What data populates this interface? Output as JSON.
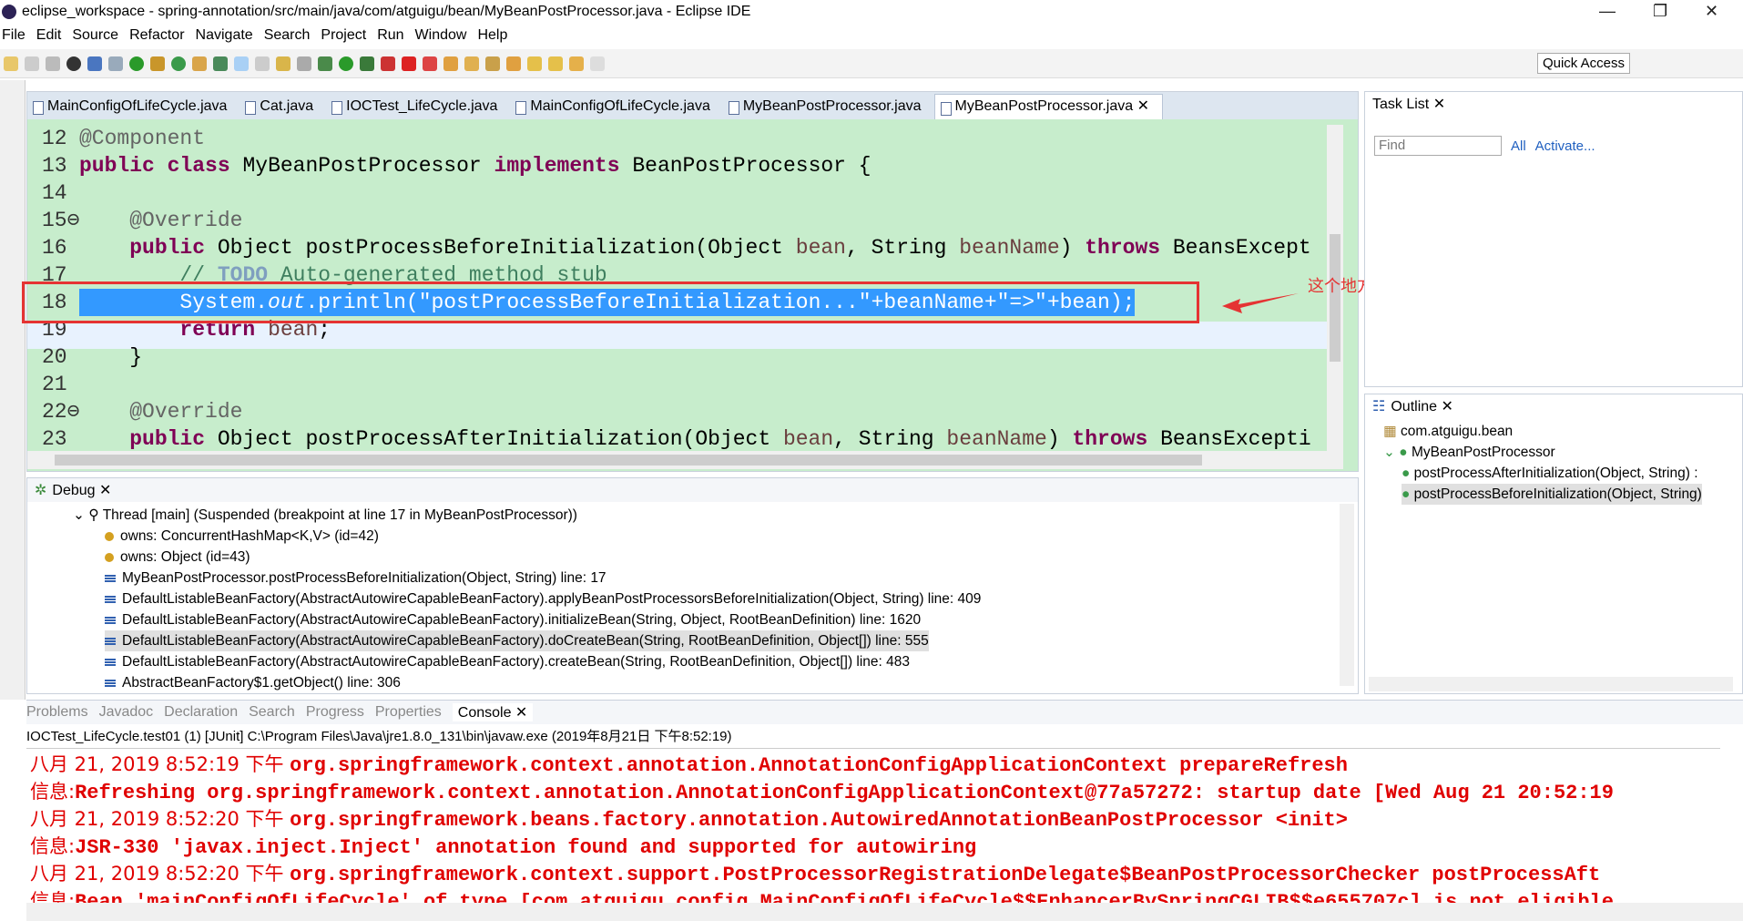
{
  "window": {
    "title": "eclipse_workspace - spring-annotation/src/main/java/com/atguigu/bean/MyBeanPostProcessor.java - Eclipse IDE",
    "minimize": "—",
    "restore": "❐",
    "close": "✕"
  },
  "menu": [
    "File",
    "Edit",
    "Source",
    "Refactor",
    "Navigate",
    "Search",
    "Project",
    "Run",
    "Window",
    "Help"
  ],
  "toolbar": {
    "quick_access": "Quick Access"
  },
  "editor": {
    "tabs": [
      "MainConfigOfLifeCycle.java",
      "Cat.java",
      "IOCTest_LifeCycle.java",
      "MainConfigOfLifeCycle.java",
      "MyBeanPostProcessor.java",
      "MyBeanPostProcessor.java ✕"
    ],
    "active_tab": 5,
    "selected_line": 18,
    "lines": [
      {
        "n": "12",
        "t": [
          [
            "a",
            "@Component"
          ]
        ]
      },
      {
        "n": "13",
        "t": [
          [
            "k",
            "public"
          ],
          [
            "p",
            " "
          ],
          [
            "k",
            "class"
          ],
          [
            "p",
            " MyBeanPostProcessor "
          ],
          [
            "k",
            "implements"
          ],
          [
            "p",
            " BeanPostProcessor {"
          ]
        ]
      },
      {
        "n": "14",
        "t": []
      },
      {
        "n": "15⊖",
        "t": [
          [
            "p",
            "    "
          ],
          [
            "a",
            "@Override"
          ]
        ]
      },
      {
        "n": "16",
        "t": [
          [
            "p",
            "    "
          ],
          [
            "k",
            "public"
          ],
          [
            "p",
            " Object postProcessBeforeInitialization(Object "
          ],
          [
            "v",
            "bean"
          ],
          [
            "p",
            ", String "
          ],
          [
            "v",
            "beanName"
          ],
          [
            "p",
            ") "
          ],
          [
            "k",
            "throws"
          ],
          [
            "p",
            " BeansExcept"
          ]
        ]
      },
      {
        "n": "17",
        "t": [
          [
            "p",
            "        "
          ],
          [
            "c",
            "// "
          ],
          [
            "td",
            "TODO"
          ],
          [
            "c",
            " Auto-generated method stub"
          ]
        ]
      },
      {
        "n": "18",
        "t": [
          [
            "p",
            "        System."
          ],
          [
            "f",
            "out"
          ],
          [
            "p",
            ".println("
          ],
          [
            "s",
            "\"postProcessBeforeInitialization...\""
          ],
          [
            "p",
            "+beanName+"
          ],
          [
            "s",
            "\"=>\""
          ],
          [
            "p",
            "+bean);"
          ]
        ]
      },
      {
        "n": "19",
        "t": [
          [
            "p",
            "        "
          ],
          [
            "k",
            "return"
          ],
          [
            "p",
            " "
          ],
          [
            "v",
            "bean"
          ],
          [
            "p",
            ";"
          ]
        ]
      },
      {
        "n": "20",
        "t": [
          [
            "p",
            "    }"
          ]
        ]
      },
      {
        "n": "21",
        "t": []
      },
      {
        "n": "22⊖",
        "t": [
          [
            "p",
            "    "
          ],
          [
            "a",
            "@Override"
          ]
        ]
      },
      {
        "n": "23",
        "t": [
          [
            "p",
            "    "
          ],
          [
            "k",
            "public"
          ],
          [
            "p",
            " Object postProcessAfterInitialization(Object "
          ],
          [
            "v",
            "bean"
          ],
          [
            "p",
            ", String "
          ],
          [
            "v",
            "beanName"
          ],
          [
            "p",
            ") "
          ],
          [
            "k",
            "throws"
          ],
          [
            "p",
            " BeansExcepti"
          ]
        ]
      }
    ]
  },
  "annotation": {
    "text": "这个地方打端点，看这个方法何时被调用",
    "color": "#e53333"
  },
  "debug": {
    "title": "Debug ✕",
    "items": [
      {
        "icon": "thread",
        "indent": 0,
        "text": "Thread [main] (Suspended (breakpoint at line 17 in MyBeanPostProcessor))"
      },
      {
        "icon": "lock",
        "indent": 1,
        "text": "owns: ConcurrentHashMap<K,V>  (id=42)"
      },
      {
        "icon": "lock",
        "indent": 1,
        "text": "owns: Object  (id=43)"
      },
      {
        "icon": "stack",
        "indent": 1,
        "text": "MyBeanPostProcessor.postProcessBeforeInitialization(Object, String) line: 17"
      },
      {
        "icon": "stack",
        "indent": 1,
        "text": "DefaultListableBeanFactory(AbstractAutowireCapableBeanFactory).applyBeanPostProcessorsBeforeInitialization(Object, String) line: 409"
      },
      {
        "icon": "stack",
        "indent": 1,
        "text": "DefaultListableBeanFactory(AbstractAutowireCapableBeanFactory).initializeBean(String, Object, RootBeanDefinition) line: 1620"
      },
      {
        "icon": "stack",
        "indent": 1,
        "text": "DefaultListableBeanFactory(AbstractAutowireCapableBeanFactory).doCreateBean(String, RootBeanDefinition, Object[]) line: 555",
        "selected": true
      },
      {
        "icon": "stack",
        "indent": 1,
        "text": "DefaultListableBeanFactory(AbstractAutowireCapableBeanFactory).createBean(String, RootBeanDefinition, Object[]) line: 483"
      },
      {
        "icon": "stack",
        "indent": 1,
        "text": "AbstractBeanFactory$1.getObject() line: 306"
      }
    ]
  },
  "tasklist": {
    "title": "Task List ✕",
    "find_placeholder": "Find",
    "all": "All",
    "activate": "Activate..."
  },
  "outline": {
    "title": "Outline ✕",
    "items": [
      {
        "indent": 0,
        "text": "com.atguigu.bean"
      },
      {
        "indent": 0,
        "text": "MyBeanPostProcessor"
      },
      {
        "indent": 1,
        "text": "postProcessAfterInitialization(Object, String) :"
      },
      {
        "indent": 1,
        "text": "postProcessBeforeInitialization(Object, String)",
        "selected": true
      }
    ]
  },
  "bottom": {
    "tabs": [
      "Problems",
      "Javadoc",
      "Declaration",
      "Search",
      "Progress",
      "Properties",
      "Console ✕"
    ],
    "active_tab": 6,
    "launch": "IOCTest_LifeCycle.test01 (1) [JUnit] C:\\Program Files\\Java\\jre1.8.0_131\\bin\\javaw.exe (2019年8月21日 下午8:52:19)",
    "lines": [
      {
        "d": "八月 21, 2019 8:52:19 下午 ",
        "m": "org.springframework.context.annotation.AnnotationConfigApplicationContext prepareRefresh"
      },
      {
        "d": "信息:",
        "m": "Refreshing org.springframework.context.annotation.AnnotationConfigApplicationContext@77a57272: startup date [Wed Aug 21 20:52:19"
      },
      {
        "d": "八月 21, 2019 8:52:20 下午 ",
        "m": "org.springframework.beans.factory.annotation.AutowiredAnnotationBeanPostProcessor <init>"
      },
      {
        "d": "信息:",
        "m": "JSR-330 'javax.inject.Inject' annotation found and supported for autowiring"
      },
      {
        "d": "八月 21, 2019 8:52:20 下午 ",
        "m": "org.springframework.context.support.PostProcessorRegistrationDelegate$BeanPostProcessorChecker postProcessAft"
      },
      {
        "d": "信息:",
        "m": "Bean 'mainConfigOfLifeCycle' of type [com.atguigu.config.MainConfigOfLifeCycle$$EnhancerBySpringCGLIB$$e655707c] is not eligible"
      }
    ],
    "color": "#e00000"
  }
}
